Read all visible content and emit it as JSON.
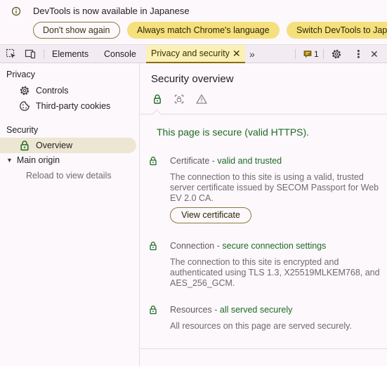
{
  "infobar": {
    "message": "DevTools is now available in Japanese",
    "buttons": {
      "dont_show": "Don't show again",
      "always_match": "Always match Chrome's language",
      "switch": "Switch DevTools to Japa"
    }
  },
  "toolbar": {
    "tabs": {
      "elements": "Elements",
      "console": "Console",
      "privacy": "Privacy and security"
    },
    "issues_count": "1",
    "icons": [
      "inspect-element-icon",
      "device-toolbar-icon",
      "close-tab-icon",
      "more-tabs-icon",
      "issues-icon",
      "gear-icon",
      "kebab-menu-icon",
      "close-devtools-icon"
    ]
  },
  "sidebar": {
    "privacy_heading": "Privacy",
    "privacy_items": [
      {
        "label": "Controls",
        "icon": "gear-icon"
      },
      {
        "label": "Third-party cookies",
        "icon": "cookie-icon"
      }
    ],
    "security_heading": "Security",
    "overview_label": "Overview",
    "main_origin_label": "Main origin",
    "reload_hint": "Reload to view details"
  },
  "main": {
    "title": "Security overview",
    "secure_heading": "This page is secure (valid HTTPS).",
    "certificate": {
      "title": "Certificate",
      "status": "valid and trusted",
      "description": "The connection to this site is using a valid, trusted server certificate issued by SECOM Passport for Web EV 2.0 CA.",
      "button": "View certificate"
    },
    "connection": {
      "title": "Connection",
      "status": "secure connection settings",
      "description": "The connection to this site is encrypted and authenticated using TLS 1.3, X25519MLKEM768, and AES_256_GCM."
    },
    "resources": {
      "title": "Resources",
      "status": "all served securely",
      "description": "All resources on this page are served securely."
    }
  },
  "colors": {
    "secure_green": "#1e6b24",
    "active_tab_bg": "#fbf1b7",
    "button_fill": "#f5e07d"
  }
}
